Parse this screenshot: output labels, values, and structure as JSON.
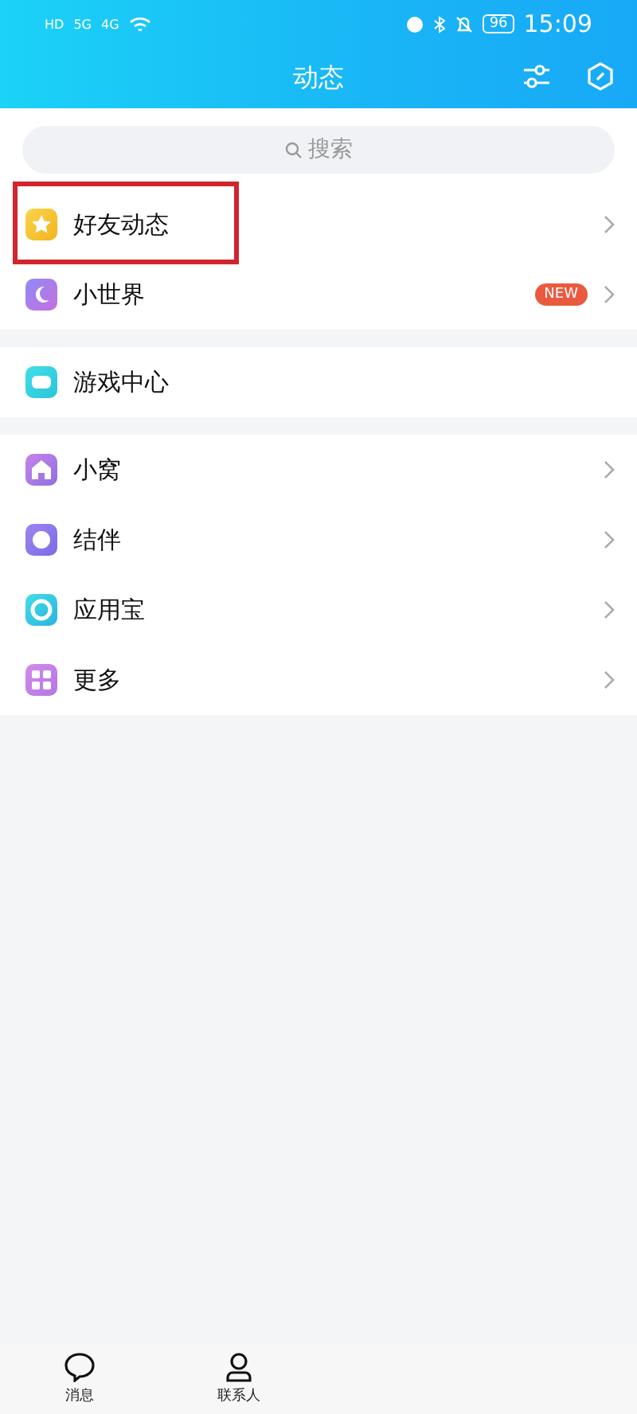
{
  "status_bar": {
    "left": [
      "HD",
      "5G",
      "4G"
    ],
    "battery": "96",
    "time": "15:09"
  },
  "header": {
    "title": "动态"
  },
  "search": {
    "placeholder": "搜索"
  },
  "groups": [
    {
      "items": [
        {
          "label": "好友动态",
          "arrow": true,
          "highlighted": true
        },
        {
          "label": "小世界",
          "badge": "NEW",
          "arrow": true,
          "highlighted": false
        }
      ]
    },
    {
      "items": [
        {
          "label": "游戏中心",
          "arrow": false,
          "highlighted": false
        }
      ]
    },
    {
      "items": [
        {
          "label": "小窝",
          "arrow": true,
          "highlighted": false
        },
        {
          "label": "结伴",
          "arrow": true,
          "highlighted": false
        },
        {
          "label": "应用宝",
          "arrow": true,
          "highlighted": false
        },
        {
          "label": "更多",
          "arrow": true,
          "highlighted": false
        }
      ]
    }
  ],
  "tabs": [
    {
      "label": "消息"
    },
    {
      "label": "联系人"
    }
  ]
}
